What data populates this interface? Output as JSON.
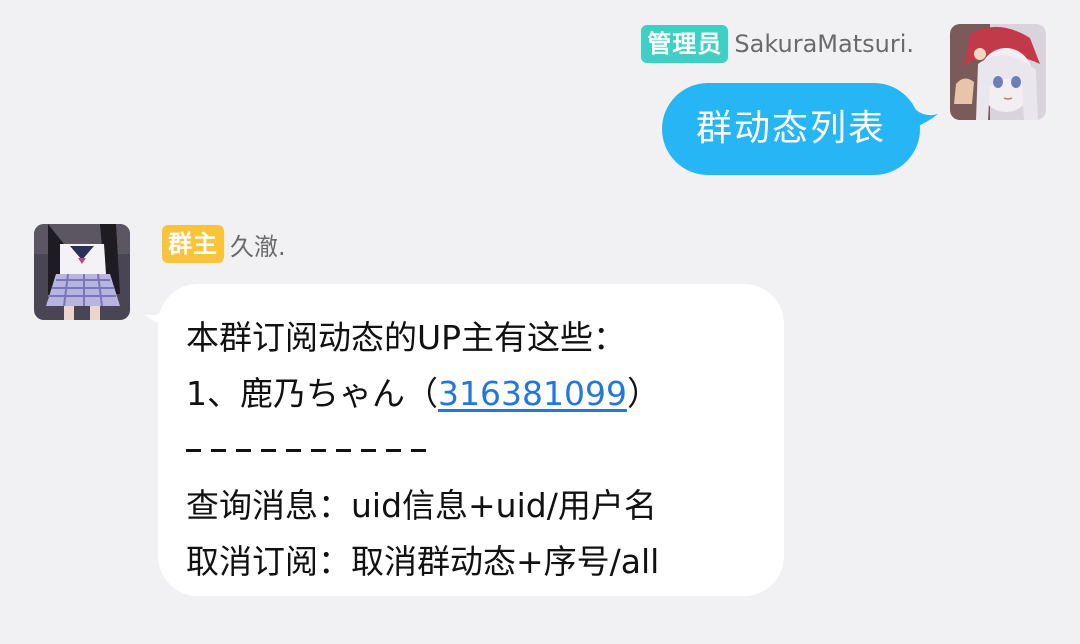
{
  "colors": {
    "background": "#f1f1f4",
    "outgoing_bubble": "#27b6f5",
    "incoming_bubble": "#ffffff",
    "admin_badge": "#3ed0c4",
    "owner_badge": "#f9c33c",
    "link": "#2277dd"
  },
  "messages": [
    {
      "direction": "outgoing",
      "badge": "管理员",
      "sender": "SakuraMatsuri.",
      "avatar_icon": "anime-girl-avatar-icon",
      "text": "群动态列表"
    },
    {
      "direction": "incoming",
      "badge": "群主",
      "sender": "久澈.",
      "avatar_icon": "anime-girl-avatar-icon",
      "lines": {
        "line1": "本群订阅动态的UP主有这些：",
        "line2_prefix": "1、鹿乃ちゃん（",
        "line2_link": "316381099",
        "line2_suffix": "）",
        "divider": "----------",
        "line4": "查询消息：uid信息+uid/用户名",
        "line5": "取消订阅：取消群动态+序号/all"
      }
    }
  ]
}
